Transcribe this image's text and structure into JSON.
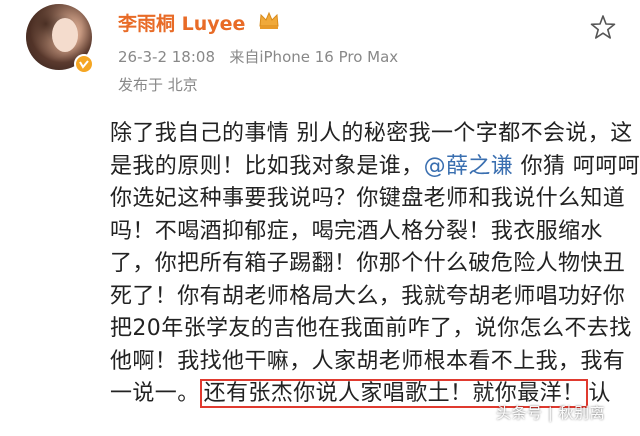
{
  "post": {
    "username": "李雨桐 Luyee",
    "timestamp": "26-3-2 18:08",
    "source": "来自iPhone 16 Pro Max",
    "location": "发布于 北京"
  },
  "body": {
    "line1": "除了我自己的事情 别人的秘密我一个字都不会说，这",
    "line2_pre": "是我的原则！比如我对象是谁，",
    "mention": "@薛之谦",
    "line2_post": " 你猜 呵呵呵",
    "line3": "你选妃这种事要我说吗？你键盘老师和我说什么知道",
    "line4": "吗！不喝酒抑郁症，喝完酒人格分裂！我衣服缩水",
    "line5": "了，你把所有箱子踢翻！你那个什么破危险人物快丑",
    "line6": "死了！你有胡老师格局大么，我就夸胡老师唱功好你",
    "line7": "把20年张学友的吉他在我面前咋了，说你怎么不去找",
    "line8": "他啊！我找他干嘛，人家胡老师根本看不上我，我有",
    "line9_pre": "一说一。",
    "line9_boxed": "还有张杰你说人家唱歌土！就你最洋！",
    "line9_post": "认"
  },
  "watermark": "头条号 | 秋别离",
  "icons": {
    "avatar": "avatar-photo",
    "verified": "verified-badge-icon",
    "crown": "crown-icon",
    "favorite": "star-icon"
  },
  "colors": {
    "username": "#e86b27",
    "mention": "#3a6fb0",
    "highlight_box": "#e03a2f",
    "meta": "#888888"
  }
}
